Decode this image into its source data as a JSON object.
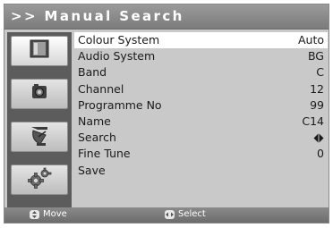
{
  "header": {
    "title": ">> Manual Search"
  },
  "sidebar": {
    "items": [
      {
        "icon": "screen-icon",
        "selected": true
      },
      {
        "icon": "camera-icon",
        "selected": false
      },
      {
        "icon": "satellite-dish-icon",
        "selected": false
      },
      {
        "icon": "gear-icon",
        "selected": false
      }
    ]
  },
  "menu": {
    "rows": [
      {
        "label": "Colour System",
        "value": "Auto",
        "selected": true
      },
      {
        "label": "Audio System",
        "value": "BG"
      },
      {
        "label": "Band",
        "value": "C"
      },
      {
        "label": "Channel",
        "value": "12"
      },
      {
        "label": "Programme No",
        "value": "99"
      },
      {
        "label": "Name",
        "value": "C14"
      },
      {
        "label": "Search",
        "value": ""
      },
      {
        "label": "Fine Tune",
        "value": "0"
      },
      {
        "label": "Save",
        "value": ""
      }
    ],
    "search_icon": "left-right-arrows-icon"
  },
  "footer": {
    "move_label": "Move",
    "select_label": "Select"
  }
}
